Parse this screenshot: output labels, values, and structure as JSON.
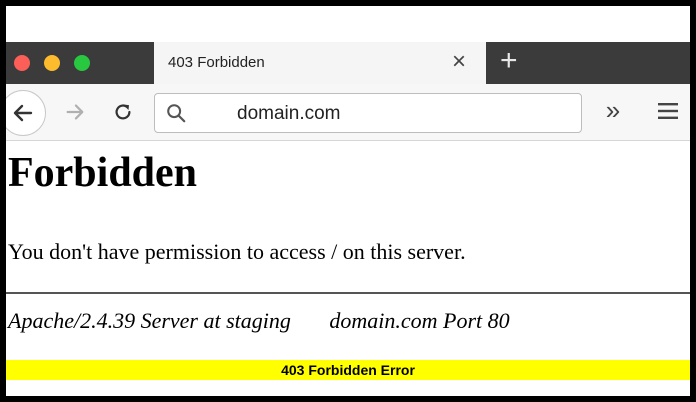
{
  "browser": {
    "tab_title": "403 Forbidden",
    "tab_close_glyph": "×",
    "new_tab_glyph": "+",
    "url": "domain.com",
    "overflow_glyph": "»",
    "traffic_lights": {
      "close": "#fc5f57",
      "minimize": "#fdbb2e",
      "zoom": "#28c840"
    },
    "icons": [
      "back-arrow-icon",
      "forward-arrow-icon",
      "reload-icon",
      "search-icon",
      "overflow-chevron-icon",
      "hamburger-menu-icon"
    ]
  },
  "page": {
    "heading": "Forbidden",
    "message": "You don't have permission to access / on this server.",
    "address": "Apache/2.4.39 Server at staging       domain.com Port 80"
  },
  "caption": "403 Forbidden Error"
}
